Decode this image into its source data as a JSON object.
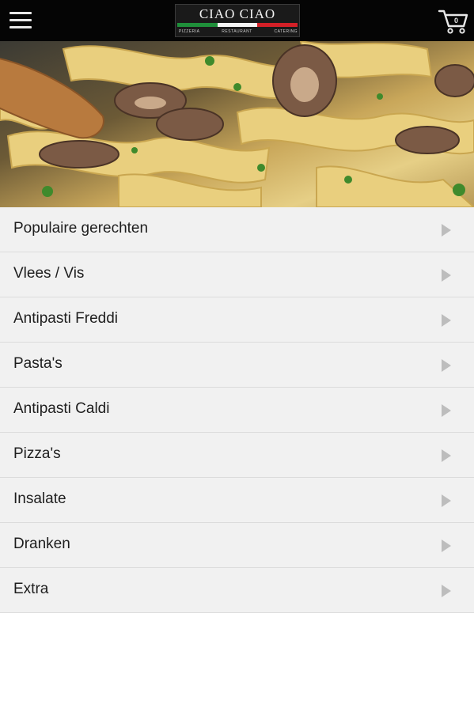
{
  "header": {
    "menu_icon": "hamburger-menu-icon",
    "logo_title": "CIAO CIAO",
    "logo_subtitles": [
      "PIZZERIA",
      "RESTAURANT",
      "CATERING"
    ],
    "cart_icon": "shopping-cart-icon",
    "cart_count": "0"
  },
  "categories": [
    {
      "label": "Populaire gerechten"
    },
    {
      "label": "Vlees / Vis"
    },
    {
      "label": "Antipasti Freddi"
    },
    {
      "label": "Pasta's"
    },
    {
      "label": "Antipasti Caldi"
    },
    {
      "label": "Pizza's"
    },
    {
      "label": "Insalate"
    },
    {
      "label": "Dranken"
    },
    {
      "label": "Extra"
    }
  ],
  "colors": {
    "topbar": "#050505",
    "list_background": "#f1f1f1",
    "arrow": "#bdbdbd",
    "flag_green": "#1f8f3a",
    "flag_red": "#d32027"
  }
}
